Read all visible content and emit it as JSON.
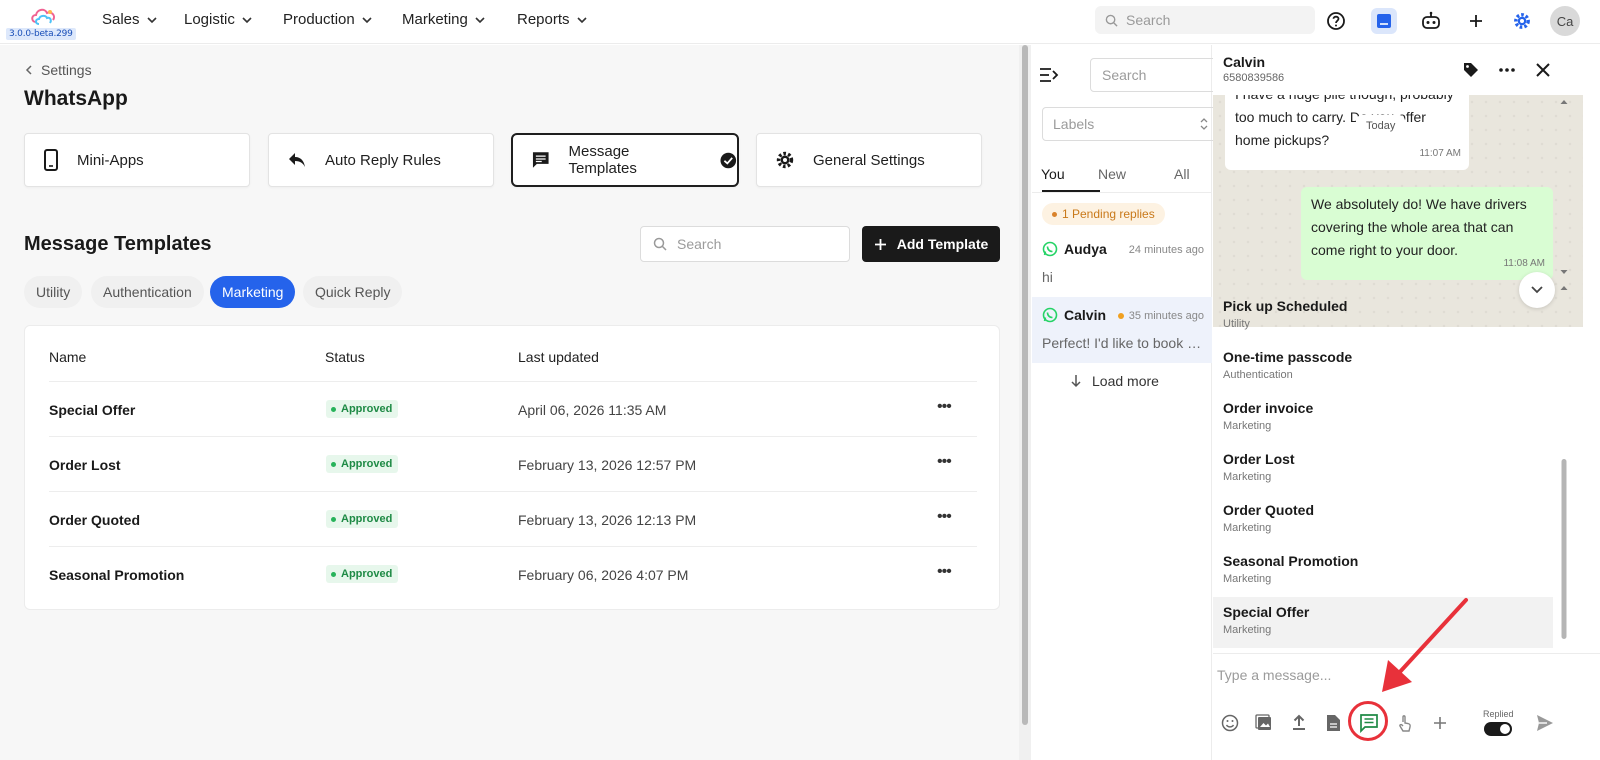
{
  "app": {
    "version": "3.0.0-beta.299",
    "colors": {
      "accent": "#2563eb",
      "approved": "#1e8a45",
      "pending": "#c9791a",
      "whatsapp": "#25d366",
      "annotation": "#e8313a"
    }
  },
  "nav": {
    "items": [
      {
        "label": "Sales"
      },
      {
        "label": "Logistic"
      },
      {
        "label": "Production"
      },
      {
        "label": "Marketing"
      },
      {
        "label": "Reports"
      }
    ],
    "search_placeholder": "Search",
    "icons": [
      "help-icon",
      "inbox-icon",
      "bot-icon",
      "plus-icon",
      "gear-icon"
    ],
    "avatar": "Ca"
  },
  "settings": {
    "breadcrumb": "Settings",
    "title": "WhatsApp",
    "cards": [
      {
        "label": "Mini-Apps",
        "icon": "phone-icon"
      },
      {
        "label": "Auto Reply Rules",
        "icon": "reply-icon"
      },
      {
        "label": "Message Templates",
        "icon": "message-icon",
        "active": true
      },
      {
        "label": "General Settings",
        "icon": "gear-icon"
      }
    ]
  },
  "templates": {
    "title": "Message Templates",
    "search_placeholder": "Search",
    "add_label": "Add Template",
    "tabs": [
      {
        "label": "Utility"
      },
      {
        "label": "Authentication"
      },
      {
        "label": "Marketing",
        "active": true
      },
      {
        "label": "Quick Reply"
      }
    ],
    "columns": {
      "name": "Name",
      "status": "Status",
      "updated": "Last updated"
    },
    "rows": [
      {
        "name": "Special Offer",
        "status": "Approved",
        "updated": "April 06, 2026 11:35 AM"
      },
      {
        "name": "Order Lost",
        "status": "Approved",
        "updated": "February 13, 2026 12:57 PM"
      },
      {
        "name": "Order Quoted",
        "status": "Approved",
        "updated": "February 13, 2026 12:13 PM"
      },
      {
        "name": "Seasonal Promotion",
        "status": "Approved",
        "updated": "February 06, 2026 4:07 PM"
      }
    ]
  },
  "conversations": {
    "search_placeholder": "Search",
    "labels_placeholder": "Labels",
    "tabs": [
      {
        "label": "You",
        "active": true
      },
      {
        "label": "New"
      },
      {
        "label": "All"
      }
    ],
    "pending": "1 Pending replies",
    "items": [
      {
        "name": "Audya",
        "time": "24 minutes ago",
        "preview": "hi"
      },
      {
        "name": "Calvin",
        "time": "35 minutes ago",
        "preview": "Perfect! I'd like to book a pickup",
        "selected": true
      }
    ],
    "load_more": "Load more"
  },
  "chat": {
    "name": "Calvin",
    "phone": "6580839586",
    "incoming": {
      "text": "I have a huge pile though, probably too much to carry. Do you offer home pickups?",
      "time": "11:07 AM"
    },
    "today": "Today",
    "outgoing": {
      "text": "We absolutely do! We have drivers covering the whole area that can come right to your door.",
      "time": "11:08 AM"
    },
    "template_list": [
      {
        "name": "Pick up Scheduled",
        "category": "Utility"
      },
      {
        "name": "One-time passcode",
        "category": "Authentication"
      },
      {
        "name": "Order invoice",
        "category": "Marketing"
      },
      {
        "name": "Order Lost",
        "category": "Marketing"
      },
      {
        "name": "Order Quoted",
        "category": "Marketing"
      },
      {
        "name": "Seasonal Promotion",
        "category": "Marketing"
      },
      {
        "name": "Special Offer",
        "category": "Marketing"
      }
    ],
    "input_placeholder": "Type a message...",
    "replied_label": "Replied"
  }
}
